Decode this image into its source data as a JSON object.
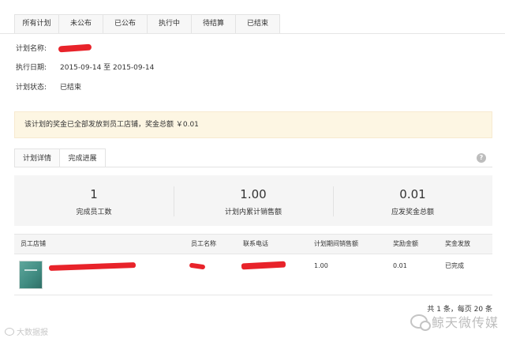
{
  "status_tabs": [
    "所有计划",
    "未公布",
    "已公布",
    "执行中",
    "待结算",
    "已结束"
  ],
  "info": {
    "name_label": "计划名称:",
    "date_label": "执行日期:",
    "date_value": "2015-09-14 至 2015-09-14",
    "status_label": "计划状态:",
    "status_value": "已结束"
  },
  "notice": "该计划的奖金已全部发放到员工店铺，奖金总额 ￥0.01",
  "sub_tabs": [
    "计划详情",
    "完成进展"
  ],
  "help_glyph": "?",
  "stats": [
    {
      "value": "1",
      "label": "完成员工数"
    },
    {
      "value": "1.00",
      "label": "计划内累计销售额"
    },
    {
      "value": "0.01",
      "label": "应发奖金总额"
    }
  ],
  "table": {
    "headers": [
      "员工店铺",
      "员工名称",
      "联系电话",
      "计划期间销售额",
      "奖励金额",
      "奖金发放"
    ],
    "rows": [
      {
        "sales": "1.00",
        "reward": "0.01",
        "payout": "已完成"
      }
    ]
  },
  "pager": "共 1 条，每页 20 条",
  "watermarks": {
    "left": "大数据报",
    "right": "鲸天微传媒"
  },
  "colors": {
    "redaction": "#e8232a",
    "notice_bg": "#fdf6e3",
    "panel_bg": "#f5f5f5"
  }
}
